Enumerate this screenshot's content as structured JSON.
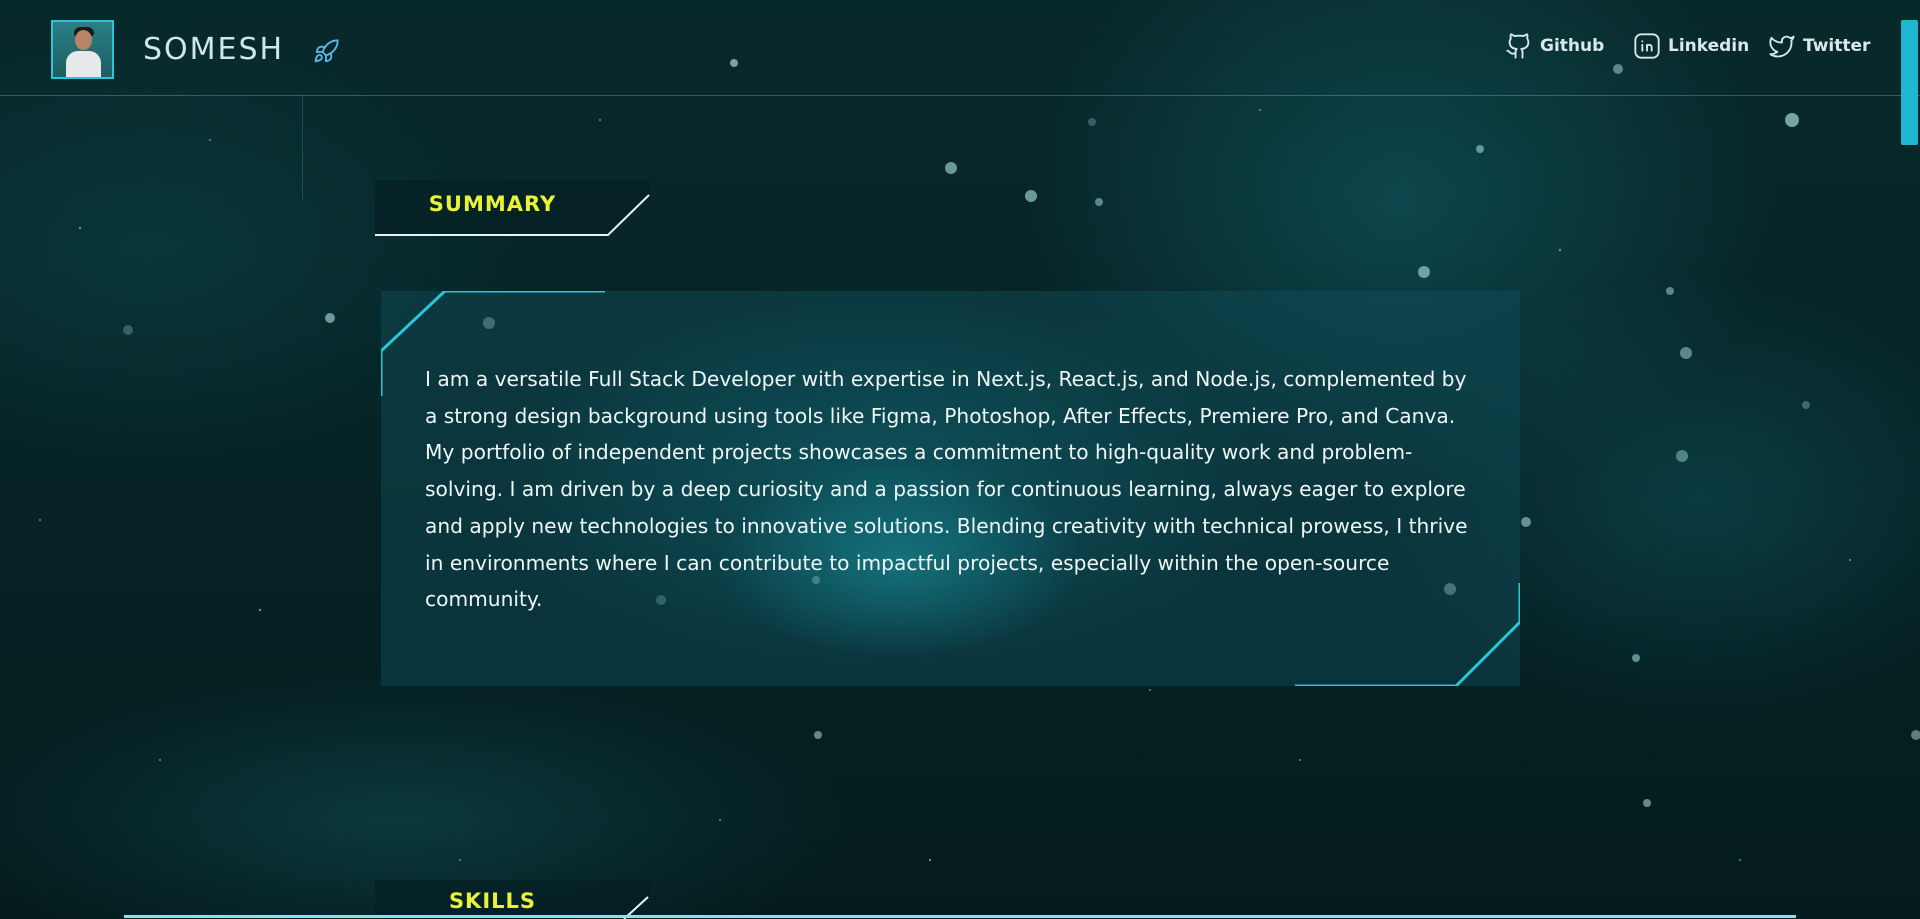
{
  "header": {
    "brand": "SOMESH",
    "avatar_icon": "profile-photo",
    "rocket_icon": "rocket-icon",
    "links": [
      {
        "label": "Github",
        "icon": "github-icon"
      },
      {
        "label": "Linkedin",
        "icon": "linkedin-icon"
      },
      {
        "label": "Twitter",
        "icon": "twitter-icon"
      }
    ]
  },
  "summary": {
    "heading": "SUMMARY",
    "text": "I am a versatile Full Stack Developer with expertise in Next.js, React.js, and Node.js, complemented by a strong design background using tools like Figma, Photoshop, After Effects, Premiere Pro, and Canva. My portfolio of independent projects showcases a commitment to high-quality work and problem-solving. I am driven by a deep curiosity and a passion for continuous learning, always eager to explore and apply new technologies to innovative solutions. Blending creativity with technical prowess, I thrive in environments where I can contribute to impactful projects, especially within the open-source community."
  },
  "skills": {
    "heading": "SKILLS"
  },
  "colors": {
    "accent": "#27c8d6",
    "heading": "#e9f23a",
    "text": "#eef6f7",
    "background": "#062325"
  }
}
